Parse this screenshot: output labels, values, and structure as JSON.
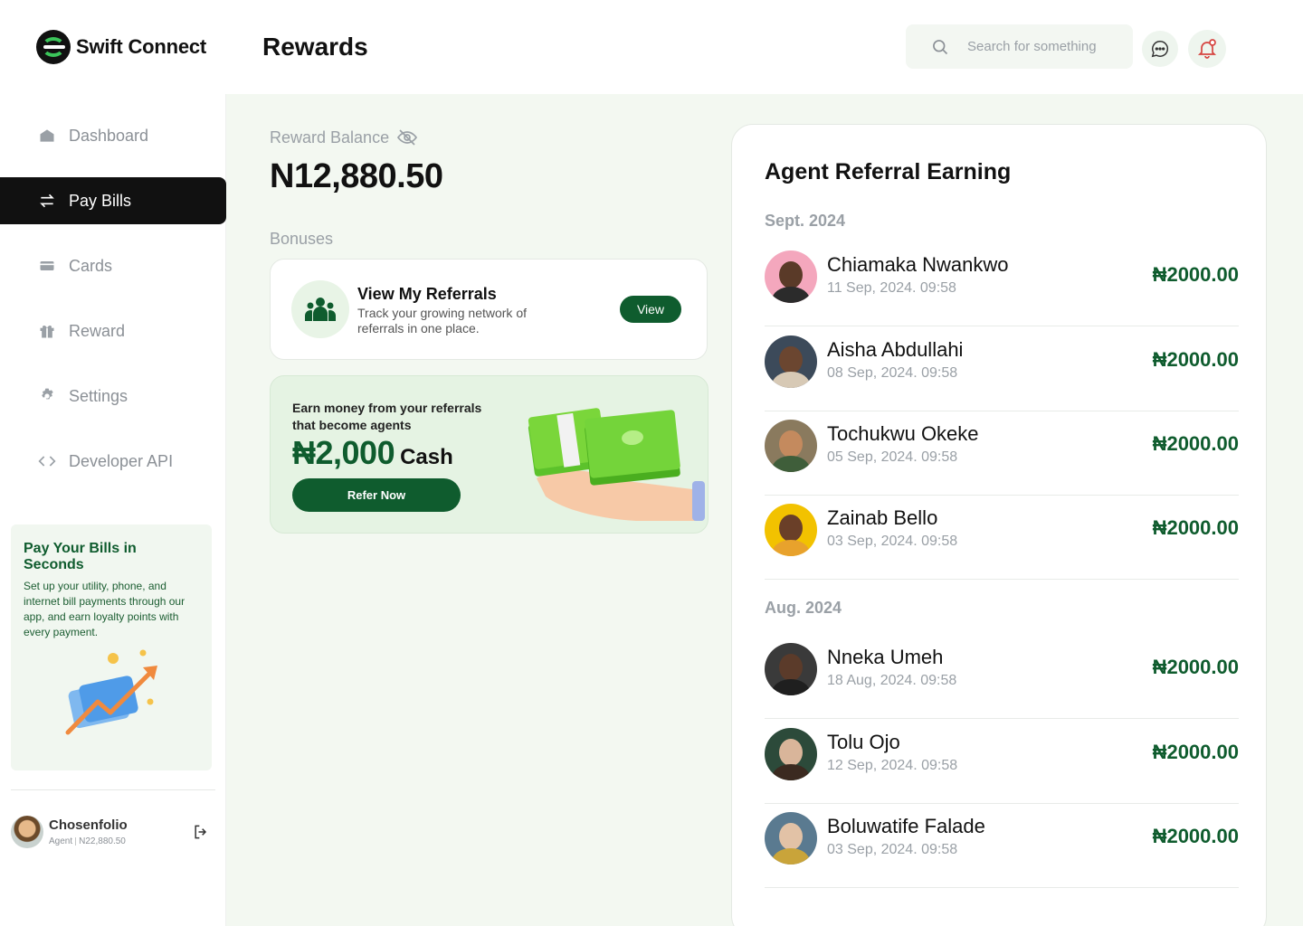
{
  "app": {
    "name": "Swift Connect",
    "page_title": "Rewards"
  },
  "search": {
    "placeholder": "Search for something"
  },
  "sidebar": {
    "items": [
      {
        "label": "Dashboard",
        "icon": "home-icon",
        "active": false
      },
      {
        "label": "Pay Bills",
        "icon": "transfer-arrows-icon",
        "active": true
      },
      {
        "label": "Cards",
        "icon": "card-icon",
        "active": false
      },
      {
        "label": "Reward",
        "icon": "gift-icon",
        "active": false
      },
      {
        "label": "Settings",
        "icon": "gear-icon",
        "active": false
      },
      {
        "label": "Developer API",
        "icon": "code-icon",
        "active": false
      }
    ],
    "promo": {
      "title": "Pay Your Bills in Seconds",
      "text": "Set up your utility, phone, and internet bill payments through our app, and earn loyalty points with every payment."
    },
    "user": {
      "name": "Chosenfolio",
      "role": "Agent",
      "balance": "N22,880.50"
    }
  },
  "balance": {
    "label": "Reward Balance",
    "value": "N12,880.50"
  },
  "bonuses": {
    "label": "Bonuses",
    "referrals": {
      "title": "View My Referrals",
      "description": "Track your growing network of referrals in one place.",
      "button": "View"
    },
    "earn": {
      "text": "Earn money from your referrals that become agents",
      "amount": "₦2,000",
      "unit": "Cash",
      "button": "Refer Now"
    }
  },
  "referral_panel": {
    "title": "Agent Referral Earning",
    "groups": [
      {
        "month": "Sept. 2024",
        "rows": [
          {
            "name": "Chiamaka Nwankwo",
            "date": "11 Sep, 2024. 09:58",
            "amount": "₦2000.00"
          },
          {
            "name": "Aisha Abdullahi",
            "date": "08 Sep, 2024. 09:58",
            "amount": "₦2000.00"
          },
          {
            "name": "Tochukwu Okeke",
            "date": "05 Sep, 2024. 09:58",
            "amount": "₦2000.00"
          },
          {
            "name": "Zainab Bello",
            "date": "03 Sep, 2024. 09:58",
            "amount": "₦2000.00"
          }
        ]
      },
      {
        "month": "Aug. 2024",
        "rows": [
          {
            "name": "Nneka Umeh",
            "date": "18 Aug, 2024. 09:58",
            "amount": "₦2000.00"
          },
          {
            "name": "Tolu Ojo",
            "date": "12 Sep, 2024. 09:58",
            "amount": "₦2000.00"
          },
          {
            "name": "Boluwatife Falade",
            "date": "03 Sep, 2024. 09:58",
            "amount": "₦2000.00"
          }
        ]
      }
    ]
  },
  "colors": {
    "brand": "#0f5c2e",
    "accent_green": "#3bc45a",
    "bg_mint": "#f3f8f1",
    "dark": "#111111",
    "muted": "#9aa0a6"
  }
}
